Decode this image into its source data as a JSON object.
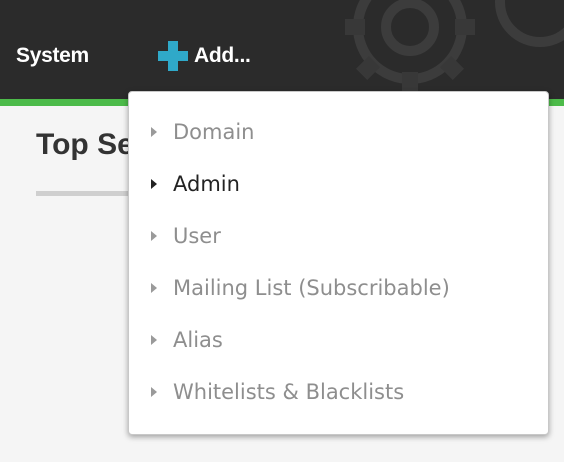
{
  "nav": {
    "system_label": "System",
    "add_label": "Add..."
  },
  "page": {
    "heading": "Top Se"
  },
  "dropdown": {
    "items": [
      {
        "label": "Domain"
      },
      {
        "label": "Admin"
      },
      {
        "label": "User"
      },
      {
        "label": "Mailing List (Subscribable)"
      },
      {
        "label": "Alias"
      },
      {
        "label": "Whitelists & Blacklists"
      }
    ],
    "active_item": "Admin"
  },
  "icons": {
    "add": "plus-icon",
    "menu_item": "triangle-right-icon",
    "background": "gear-icon"
  },
  "colors": {
    "topbar": "#2b2b2b",
    "accent_green": "#4dbb4a",
    "plus_blue": "#2fa9c9",
    "menu_text_inactive": "#8e8e8e",
    "menu_text_active": "#222222"
  }
}
